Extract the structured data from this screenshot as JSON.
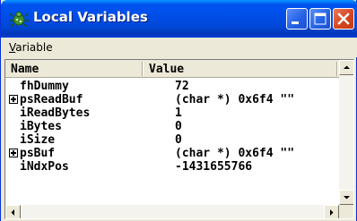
{
  "window": {
    "title": "Local Variables",
    "app_icon": "debugger-bug-icon",
    "controls": [
      "minimize-icon",
      "maximize-icon",
      "close-icon"
    ]
  },
  "menu": {
    "items": [
      {
        "label_accel": "V",
        "label_rest": "ariable"
      }
    ]
  },
  "table": {
    "columns": [
      "Name",
      "Value"
    ],
    "rows": [
      {
        "name": "fhDummy",
        "value": "72",
        "expandable": false
      },
      {
        "name": "psReadBuf",
        "value": "(char *) 0x6f4 \"\"",
        "expandable": true
      },
      {
        "name": "iReadBytes",
        "value": "1",
        "expandable": false
      },
      {
        "name": "iBytes",
        "value": "0",
        "expandable": false
      },
      {
        "name": "iSize",
        "value": "0",
        "expandable": false
      },
      {
        "name": "psBuf",
        "value": "(char *) 0x6f4 \"\"",
        "expandable": true
      },
      {
        "name": "iNdxPos",
        "value": "-1431655766",
        "expandable": false
      }
    ]
  },
  "colors": {
    "title_bar": "#0053ee",
    "close_button": "#d6461f",
    "window_face": "#ece9d8"
  }
}
